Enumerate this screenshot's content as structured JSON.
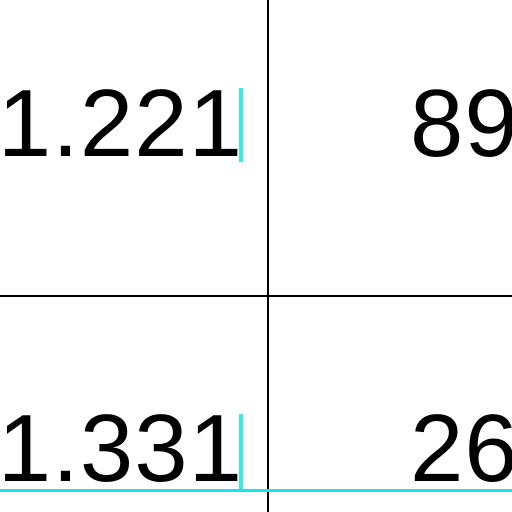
{
  "table": {
    "rows": [
      [
        "1.221",
        "89"
      ],
      [
        "1.331",
        "26"
      ]
    ]
  },
  "colors": {
    "grid_line": "#000000",
    "selection": "#17e6e6",
    "background": "#ffffff",
    "text": "#000000"
  }
}
